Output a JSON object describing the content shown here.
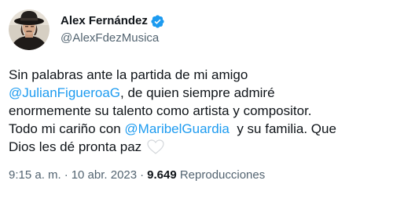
{
  "author": {
    "display_name": "Alex Fernández",
    "handle": "@AlexFdezMusica",
    "verified_icon": "verified-badge-icon",
    "badge_color": "#1d9bf0"
  },
  "tweet": {
    "line1": "Sin palabras ante la partida de mi amigo",
    "mention1": "@JulianFigueroaG",
    "line2_rest": ", de quien siempre admiré",
    "line3": "enormemente su talento como artista y compositor.",
    "line4_start": "Todo mi cariño con ",
    "mention2": "@MaribelGuardia",
    "line4_end": "  y su familia. Que",
    "line5": "Dios les dé pronta paz ",
    "emoji_icon": "white-heart-icon",
    "mention_color": "#1d9bf0"
  },
  "meta": {
    "time": "9:15 a. m.",
    "separator": "·",
    "date": "10 abr. 2023",
    "views_count": "9.649",
    "views_label": "Reproducciones"
  }
}
